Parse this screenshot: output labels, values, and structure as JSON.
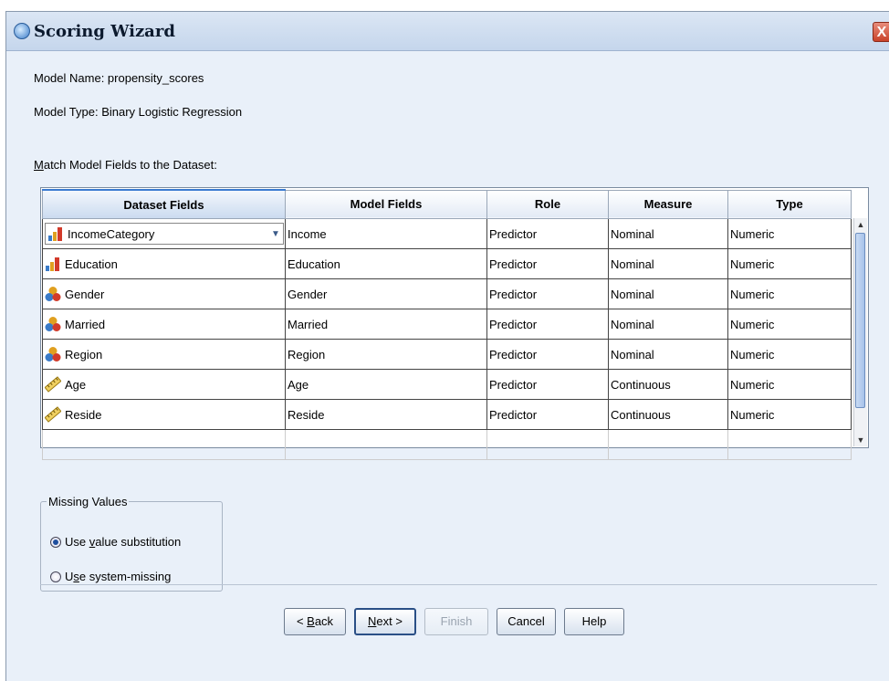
{
  "window": {
    "title": "Scoring Wizard",
    "close_label": "X"
  },
  "model": {
    "name_text": "Model Name: propensity_scores",
    "type_text": "Model Type: Binary Logistic Regression",
    "match_label": "Match Model Fields to the Dataset:"
  },
  "grid": {
    "headers": [
      "Dataset Fields",
      "Model Fields",
      "Role",
      "Measure",
      "Type"
    ],
    "rows": [
      {
        "dataset": "IncomeCategory",
        "icon": "ordinal-bar-icon",
        "model": "Income",
        "role": "Predictor",
        "measure": "Nominal",
        "type": "Numeric"
      },
      {
        "dataset": "Education",
        "icon": "ordinal-bar-icon",
        "model": "Education",
        "role": "Predictor",
        "measure": "Nominal",
        "type": "Numeric"
      },
      {
        "dataset": "Gender",
        "icon": "nominal-circles-icon",
        "model": "Gender",
        "role": "Predictor",
        "measure": "Nominal",
        "type": "Numeric"
      },
      {
        "dataset": "Married",
        "icon": "nominal-circles-icon",
        "model": "Married",
        "role": "Predictor",
        "measure": "Nominal",
        "type": "Numeric"
      },
      {
        "dataset": "Region",
        "icon": "nominal-circles-icon",
        "model": "Region",
        "role": "Predictor",
        "measure": "Nominal",
        "type": "Numeric"
      },
      {
        "dataset": "Age",
        "icon": "scale-ruler-icon",
        "model": "Age",
        "role": "Predictor",
        "measure": "Continuous",
        "type": "Numeric"
      },
      {
        "dataset": "Reside",
        "icon": "scale-ruler-icon",
        "model": "Reside",
        "role": "Predictor",
        "measure": "Continuous",
        "type": "Numeric"
      }
    ]
  },
  "missing_values": {
    "legend": "Missing Values",
    "options": [
      {
        "label_pre": "Use ",
        "label_ul": "v",
        "label_post": "alue substitution",
        "selected": true
      },
      {
        "label_pre": "U",
        "label_ul": "s",
        "label_post": "e system-missing",
        "selected": false
      }
    ]
  },
  "buttons": {
    "back_pre": "< ",
    "back_ul": "B",
    "back_post": "ack",
    "next_ul": "N",
    "next_post": "ext >",
    "finish": "Finish",
    "cancel": "Cancel",
    "help": "Help"
  },
  "colors": {
    "selected_header_border": "#3b7bd1",
    "window_bg": "#e9f0f9"
  }
}
